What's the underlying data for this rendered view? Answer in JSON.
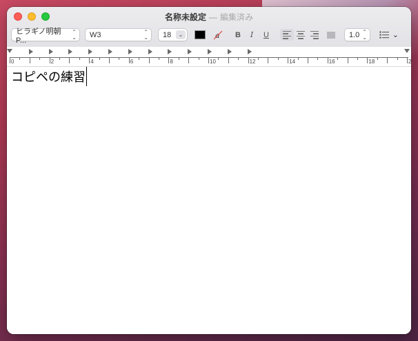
{
  "window": {
    "title": "名称未設定",
    "separator": "—",
    "status": "編集済み"
  },
  "toolbar": {
    "font_family": "ヒラギノ明朝 P...",
    "font_style": "W3",
    "font_size": "18",
    "text_color": "#000000",
    "bold_label": "B",
    "italic_label": "I",
    "underline_label": "U",
    "line_spacing": "1.0"
  },
  "ruler": {
    "numbers": [
      "0",
      "2",
      "4",
      "6",
      "8",
      "10",
      "12",
      "14",
      "16",
      "18",
      "20"
    ]
  },
  "document": {
    "text": "コピペの練習"
  }
}
